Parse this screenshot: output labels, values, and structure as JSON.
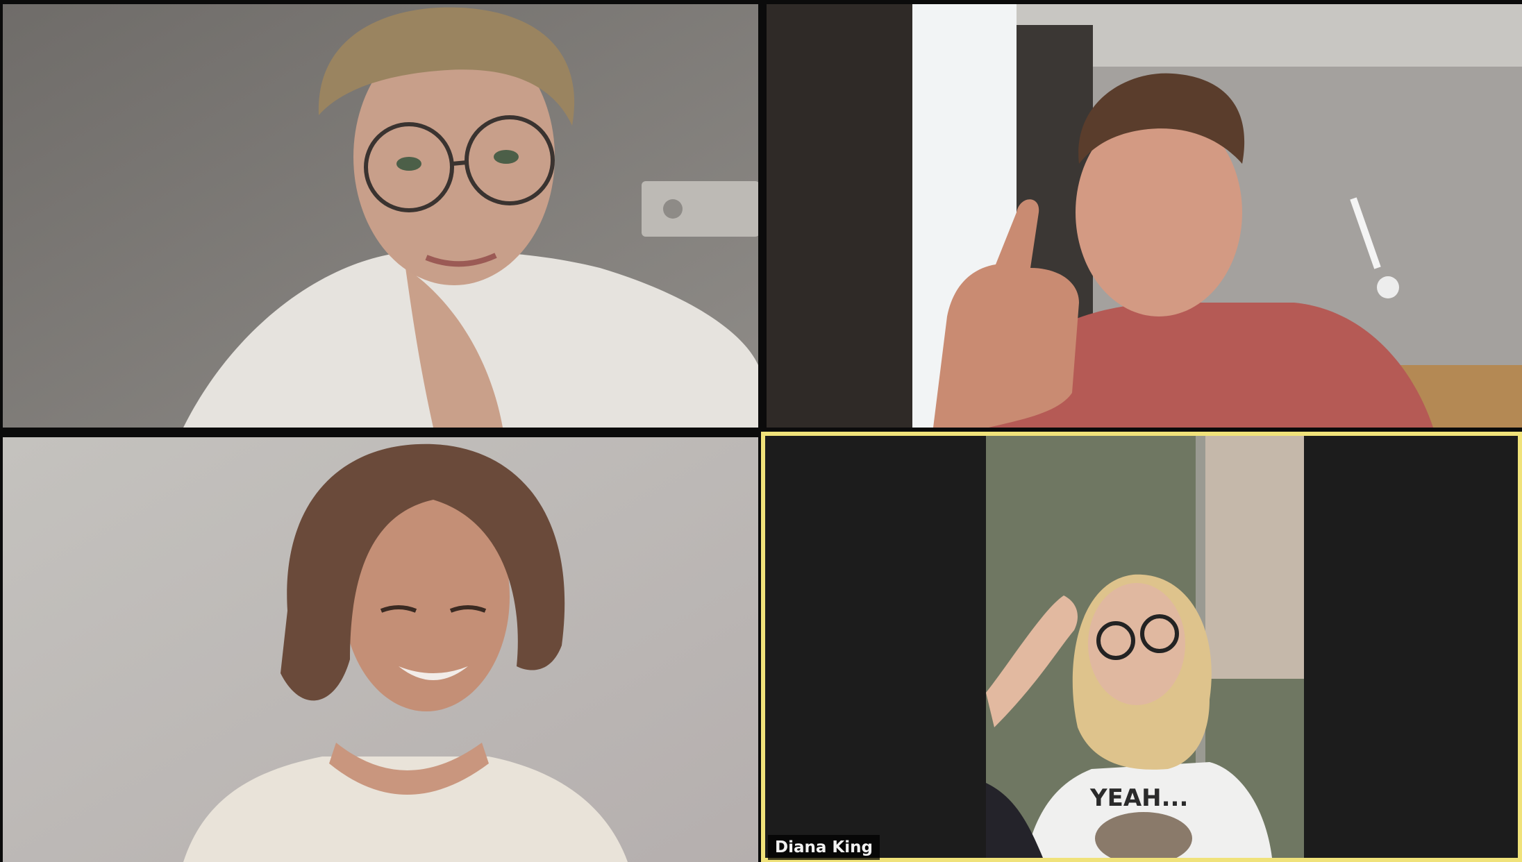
{
  "participants": [
    {
      "role": "video-tile",
      "active_speaker": false
    },
    {
      "role": "video-tile",
      "active_speaker": false
    },
    {
      "role": "video-tile",
      "active_speaker": false
    },
    {
      "role": "video-tile",
      "active_speaker": true,
      "name": "Diana King"
    }
  ],
  "colors": {
    "active_speaker_border": "#f0e27a",
    "background": "#0b0b0b",
    "name_tag_bg": "#000000",
    "name_tag_text": "#f2f2f2"
  },
  "shirt_text": "YEAH..."
}
